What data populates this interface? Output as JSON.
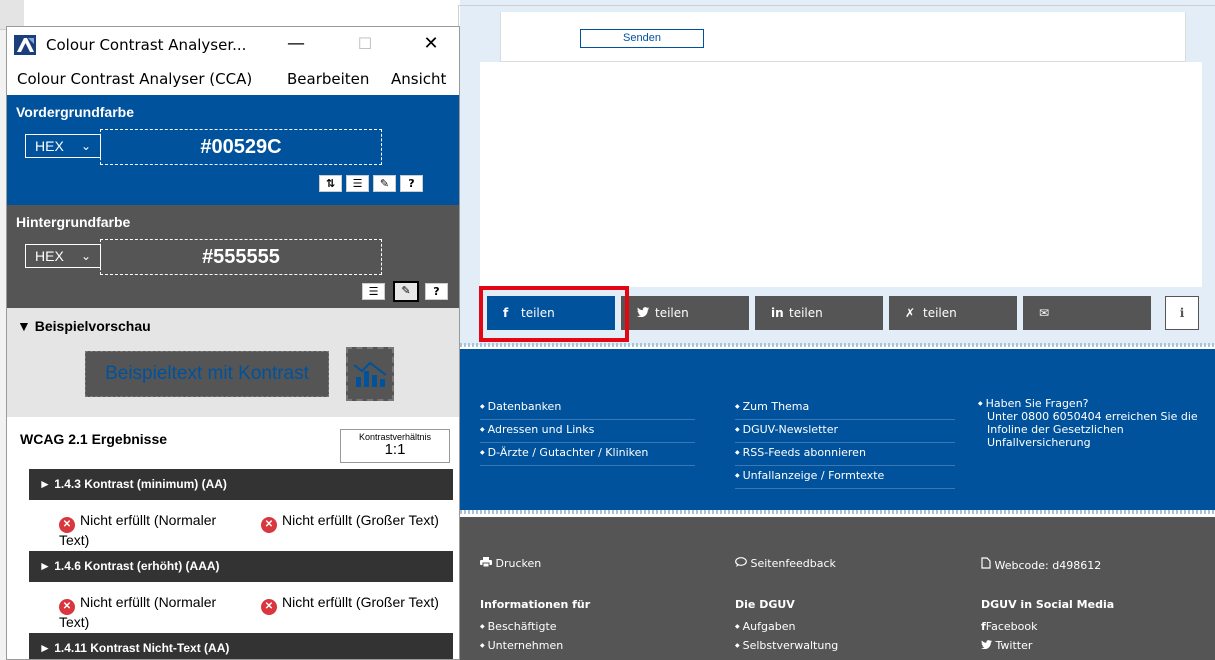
{
  "cca": {
    "title": "Colour Contrast Analyser...",
    "window_controls": {
      "minimize": "—",
      "maximize": "☐",
      "close": "✕"
    },
    "menu": [
      "Colour Contrast Analyser (CCA)",
      "Bearbeiten",
      "Ansicht"
    ],
    "foreground": {
      "label": "Vordergrundfarbe",
      "format": "HEX",
      "value": "#00529C",
      "color": "#00529c",
      "tools": [
        "swap-icon",
        "sliders-icon",
        "eyedropper-icon",
        "help-icon"
      ]
    },
    "background": {
      "label": "Hintergrundfarbe",
      "format": "HEX",
      "value": "#555555",
      "color": "#555555",
      "tools": [
        "sliders-icon",
        "eyedropper-icon",
        "help-icon"
      ]
    },
    "preview": {
      "label": "▼ Beispielvorschau",
      "sample_text": "Beispieltext mit Kontrast"
    },
    "results": {
      "heading": "WCAG 2.1 Ergebnisse",
      "ratio_label": "Kontrastverhältnis",
      "ratio_value": "1:1",
      "criteria": [
        {
          "label": "► 1.4.3 Kontrast (minimum) (AA)",
          "normal": "Nicht erfüllt (Normaler Text)",
          "large": "Nicht erfüllt (Großer Text)"
        },
        {
          "label": "► 1.4.6 Kontrast (erhöht) (AAA)",
          "normal": "Nicht erfüllt (Normaler Text)",
          "large": "Nicht erfüllt (Großer Text)"
        },
        {
          "label": "► 1.4.11 Kontrast Nicht-Text (AA)"
        }
      ]
    }
  },
  "website": {
    "send_button": "Senden",
    "share": [
      {
        "icon": "f",
        "label": "teilen",
        "icon_name": "facebook-icon"
      },
      {
        "icon": "🐦",
        "label": "teilen",
        "icon_name": "twitter-icon"
      },
      {
        "icon": "in",
        "label": "teilen",
        "icon_name": "linkedin-icon"
      },
      {
        "icon": "✗",
        "label": "teilen",
        "icon_name": "xing-icon"
      },
      {
        "icon": "✉",
        "label": "",
        "icon_name": "mail-icon"
      }
    ],
    "info_button": "i",
    "footer_links": {
      "col1": [
        "Datenbanken",
        "Adressen und Links",
        "D-Ärzte / Gutachter / Kliniken"
      ],
      "col2": [
        "Zum Thema",
        "DGUV-Newsletter",
        "RSS-Feeds abonnieren",
        "Unfallanzeige / Formtexte"
      ],
      "faq_question": "Haben Sie Fragen?",
      "faq_answer": "Unter 0800 6050404 erreichen Sie die Infoline der Gesetzlichen Unfallversicherung"
    },
    "footer_bottom": {
      "print": "Drucken",
      "feedback": "Seitenfeedback",
      "webcode": "Webcode: d498612",
      "info_for": "Informationen für",
      "info_for_items": [
        "Beschäftigte",
        "Unternehmen"
      ],
      "dguv": "Die DGUV",
      "dguv_items": [
        "Aufgaben",
        "Selbstverwaltung"
      ],
      "social": "DGUV in Social Media",
      "social_items": [
        "Facebook",
        "Twitter"
      ]
    }
  },
  "colors": {
    "dguv_blue": "#00529c",
    "grey": "#555555",
    "highlight_red": "#e30613",
    "fail_red": "#d9363e"
  }
}
